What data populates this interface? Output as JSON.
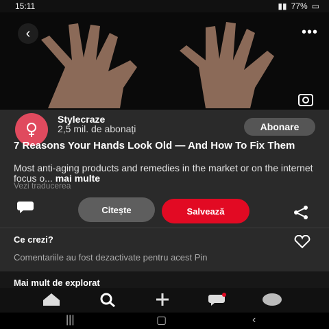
{
  "status_bar": {
    "time": "15:11",
    "battery": "77%"
  },
  "hero": {
    "alt_icon": "hands-photo"
  },
  "creator": {
    "name": "Stylecraze",
    "subscribers": "2,5 mil. de abonați",
    "follow_label": "Abonare"
  },
  "pin": {
    "title": "7 Reasons Your Hands Look Old — And How To Fix Them",
    "description": "Most anti-aging products and remedies in the market or on the internet focus o...",
    "more_label": "mai multe",
    "translate_label": "Vezi traducerea"
  },
  "actions": {
    "read_label": "Citește",
    "save_label": "Salvează"
  },
  "comments": {
    "question": "Ce crezi?",
    "disabled_text": "Comentariile au fost dezactivate pentru acest Pin"
  },
  "explore": {
    "label": "Mai mult de explorat"
  },
  "colors": {
    "save": "#e20a23",
    "avatar": "#e04a5e",
    "card": "#2a2a2a"
  }
}
